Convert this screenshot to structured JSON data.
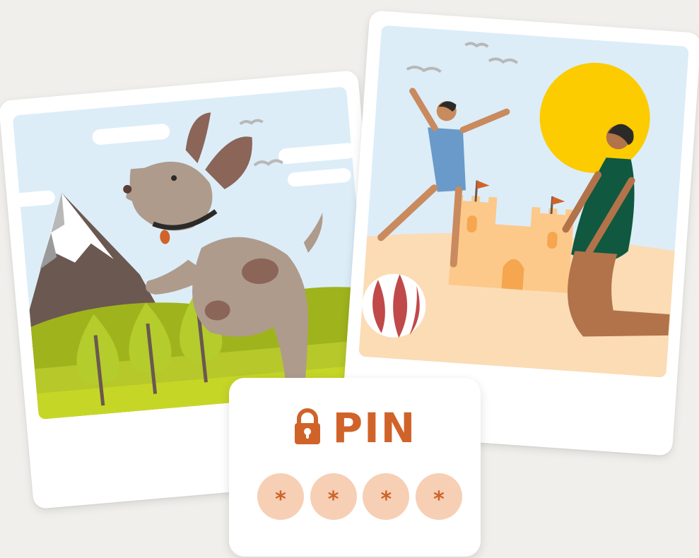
{
  "pin_card": {
    "title": "PIN",
    "digits": [
      "*",
      "*",
      "*",
      "*"
    ]
  },
  "icons": {
    "lock": "lock-icon"
  },
  "colors": {
    "accent": "#d0632a",
    "dot_fill": "#f6cfb4",
    "background": "#f0efeb"
  }
}
